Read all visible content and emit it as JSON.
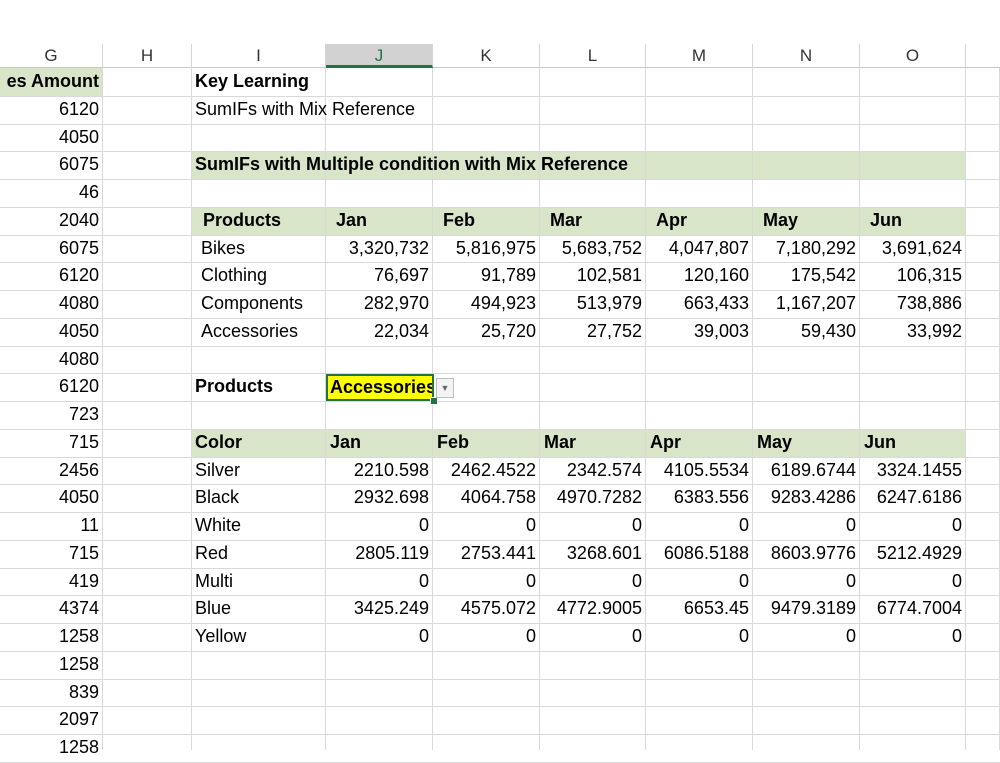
{
  "columns": [
    "G",
    "H",
    "I",
    "J",
    "K",
    "L",
    "M",
    "N",
    "O"
  ],
  "selected_column": "J",
  "g_header": "es Amount",
  "g_values": [
    "6120",
    "4050",
    "6075",
    "46",
    "2040",
    "6075",
    "6120",
    "4080",
    "4050",
    "4080",
    "6120",
    "723",
    "715",
    "2456",
    "4050",
    "11",
    "715",
    "419",
    "4374",
    "1258",
    "1258",
    "839",
    "2097",
    "1258"
  ],
  "key_learning": {
    "title": "Key Learning",
    "subtitle": "SumIFs with Mix Reference"
  },
  "section_title": "SumIFs with Multiple condition with Mix Reference",
  "table1": {
    "headers": [
      "Products",
      "Jan",
      "Feb",
      "Mar",
      "Apr",
      "May",
      "Jun"
    ],
    "rows": [
      [
        "Bikes",
        "3,320,732",
        "5,816,975",
        "5,683,752",
        "4,047,807",
        "7,180,292",
        "3,691,624"
      ],
      [
        "Clothing",
        "76,697",
        "91,789",
        "102,581",
        "120,160",
        "175,542",
        "106,315"
      ],
      [
        "Components",
        "282,970",
        "494,923",
        "513,979",
        "663,433",
        "1,167,207",
        "738,886"
      ],
      [
        "Accessories",
        "22,034",
        "25,720",
        "27,752",
        "39,003",
        "59,430",
        "33,992"
      ]
    ]
  },
  "filter": {
    "label": "Products",
    "value": "Accessories",
    "dropdown_icon": "chevron-down-icon"
  },
  "table2": {
    "headers": [
      "Color",
      "Jan",
      "Feb",
      "Mar",
      "Apr",
      "May",
      "Jun"
    ],
    "rows": [
      [
        "Silver",
        "2210.598",
        "2462.4522",
        "2342.574",
        "4105.5534",
        "6189.6744",
        "3324.1455"
      ],
      [
        "Black",
        "2932.698",
        "4064.758",
        "4970.7282",
        "6383.556",
        "9283.4286",
        "6247.6186"
      ],
      [
        "White",
        "0",
        "0",
        "0",
        "0",
        "0",
        "0"
      ],
      [
        "Red",
        "2805.119",
        "2753.441",
        "3268.601",
        "6086.5188",
        "8603.9776",
        "5212.4929"
      ],
      [
        "Multi",
        "0",
        "0",
        "0",
        "0",
        "0",
        "0"
      ],
      [
        "Blue",
        "3425.249",
        "4575.072",
        "4772.9005",
        "6653.45",
        "9479.3189",
        "6774.7004"
      ],
      [
        "Yellow",
        "0",
        "0",
        "0",
        "0",
        "0",
        "0"
      ]
    ]
  },
  "colors": {
    "band": "#d9e5c8",
    "dropdown_cell": "#ffff00",
    "selection": "#217346"
  }
}
